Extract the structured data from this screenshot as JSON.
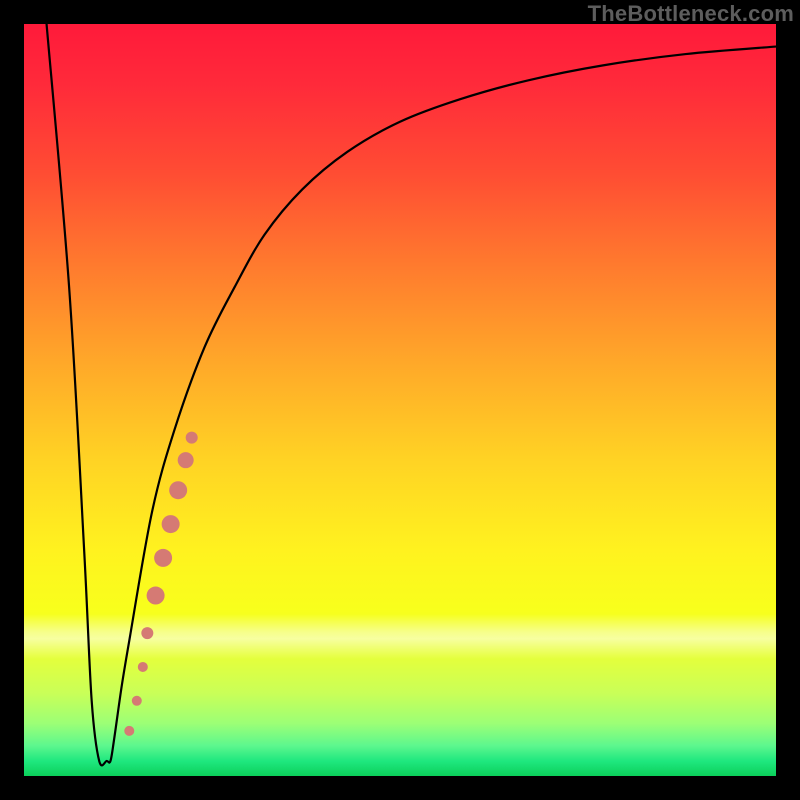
{
  "watermark": "TheBottleneck.com",
  "chart_data": {
    "type": "line",
    "title": "",
    "xlabel": "",
    "ylabel": "",
    "xlim": [
      0,
      100
    ],
    "ylim": [
      0,
      100
    ],
    "grid": false,
    "series": [
      {
        "name": "bottleneck-curve",
        "x": [
          3,
          6,
          8,
          9,
          10,
          11,
          11.5,
          12,
          13,
          14,
          17,
          20,
          24,
          28,
          32,
          37,
          43,
          50,
          58,
          67,
          77,
          88,
          100
        ],
        "y": [
          100,
          65,
          30,
          10,
          2,
          2,
          2,
          5,
          12,
          18,
          35,
          46,
          57,
          65,
          72,
          78,
          83,
          87,
          90,
          92.5,
          94.5,
          96,
          97
        ]
      }
    ],
    "highlight": {
      "name": "data-points-overlay",
      "color": "#d57a74",
      "points": [
        {
          "x": 14.0,
          "y": 6.0,
          "r": 5
        },
        {
          "x": 15.0,
          "y": 10.0,
          "r": 5
        },
        {
          "x": 15.8,
          "y": 14.5,
          "r": 5
        },
        {
          "x": 16.4,
          "y": 19.0,
          "r": 6
        },
        {
          "x": 17.5,
          "y": 24.0,
          "r": 9
        },
        {
          "x": 18.5,
          "y": 29.0,
          "r": 9
        },
        {
          "x": 19.5,
          "y": 33.5,
          "r": 9
        },
        {
          "x": 20.5,
          "y": 38.0,
          "r": 9
        },
        {
          "x": 21.5,
          "y": 42.0,
          "r": 8
        },
        {
          "x": 22.3,
          "y": 45.0,
          "r": 6
        }
      ]
    },
    "background_gradient": {
      "top": "#ff1a3a",
      "middle": "#fff21f",
      "bottom": "#0bcf5a"
    }
  }
}
